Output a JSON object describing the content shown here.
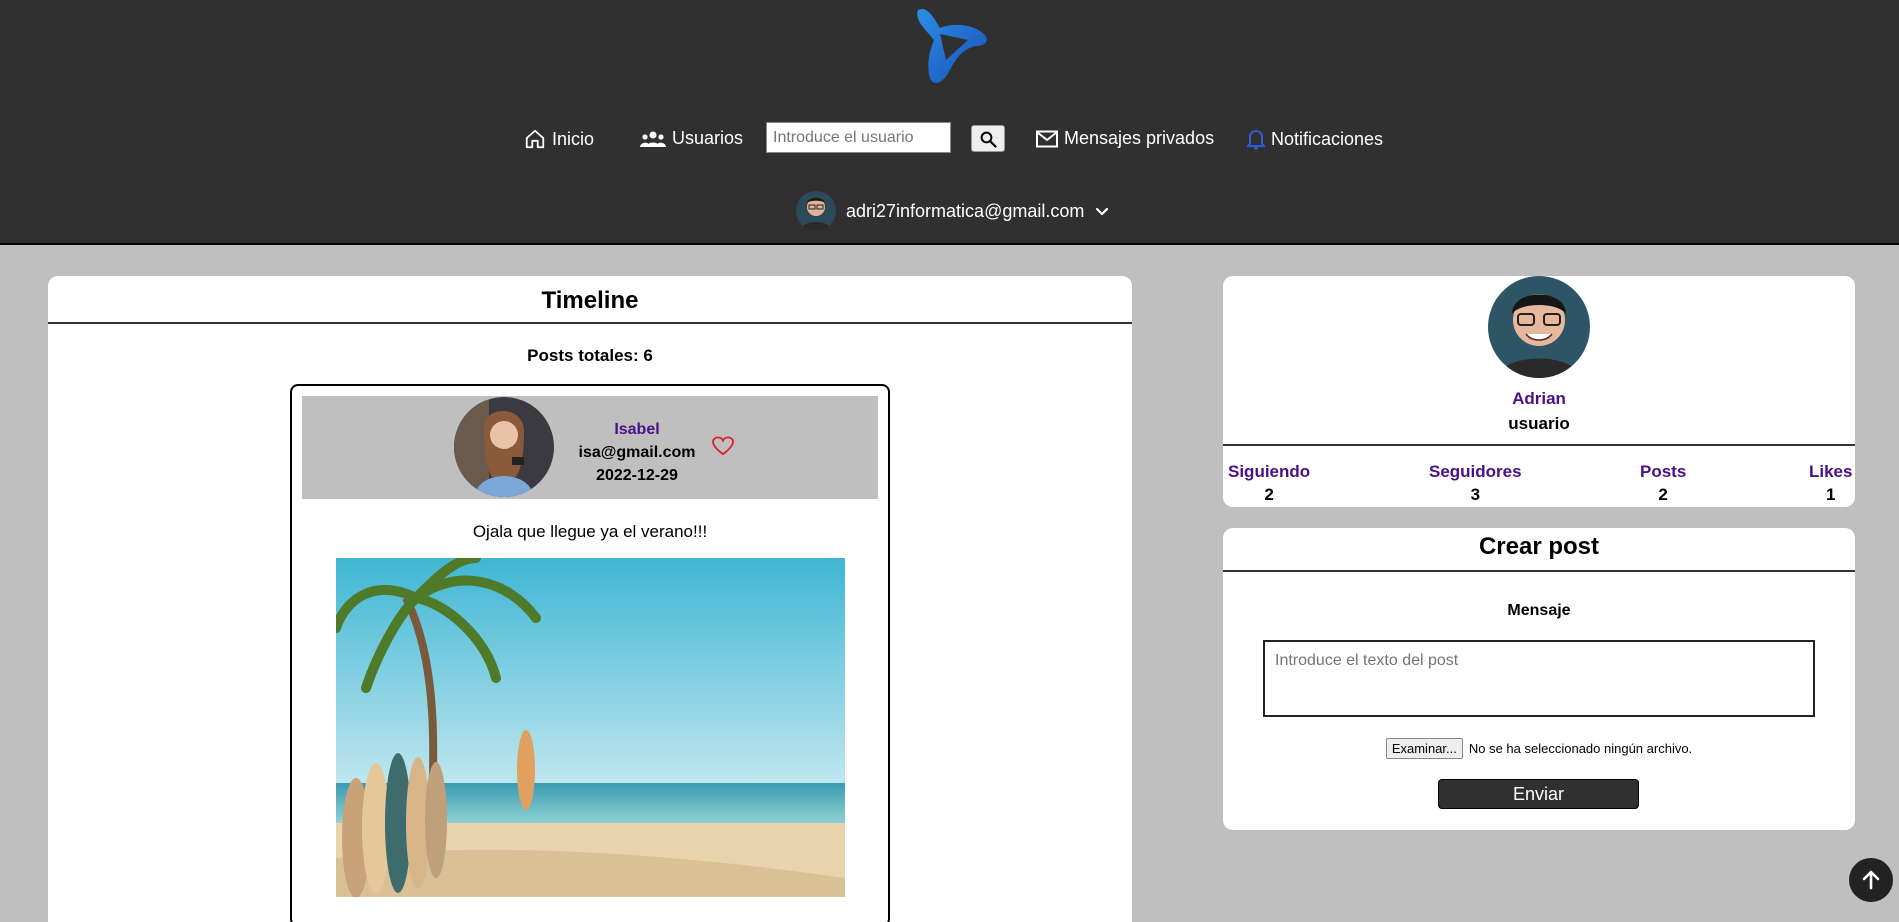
{
  "nav": {
    "home_label": "Inicio",
    "users_label": "Usuarios",
    "search_placeholder": "Introduce el usuario",
    "messages_label": "Mensajes privados",
    "notifications_label": "Notificaciones"
  },
  "user_menu": {
    "email": "adri27informatica@gmail.com"
  },
  "timeline": {
    "title": "Timeline",
    "posts_total": "Posts totales: 6",
    "post": {
      "author_name": "Isabel",
      "author_email": "isa@gmail.com",
      "date": "2022-12-29",
      "text": "Ojala que llegue ya el verano!!!"
    }
  },
  "profile": {
    "name": "Adrian",
    "role": "usuario",
    "stats": [
      {
        "label": "Siguiendo",
        "value": "2"
      },
      {
        "label": "Seguidores",
        "value": "3"
      },
      {
        "label": "Posts",
        "value": "2"
      },
      {
        "label": "Likes",
        "value": "1"
      }
    ]
  },
  "create_post": {
    "title": "Crear post",
    "message_label": "Mensaje",
    "textarea_placeholder": "Introduce el texto del post",
    "file_button": "Examinar...",
    "file_status": "No se ha seleccionado ningún archivo.",
    "send_label": "Enviar"
  },
  "colors": {
    "header_bg": "#303030",
    "page_bg": "#bfbfbf",
    "accent_purple": "#4b0f8a",
    "like_red": "#e0202a",
    "bell_blue": "#2f5bd6"
  }
}
